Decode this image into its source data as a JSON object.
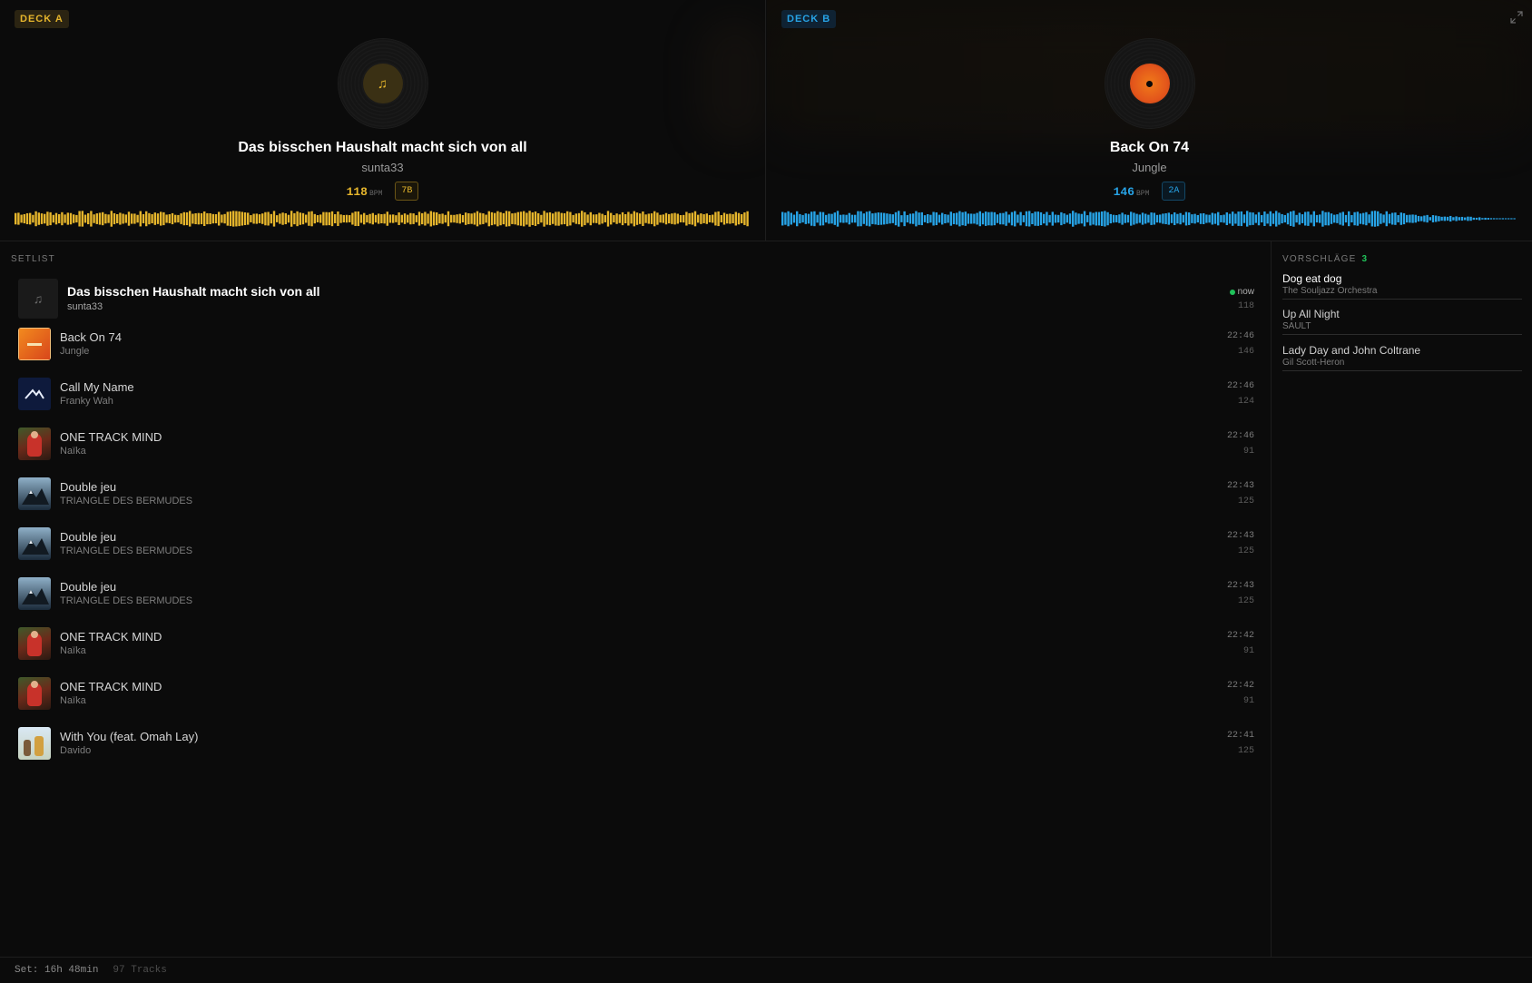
{
  "deck_a": {
    "badge": "DECK A",
    "title": "Das bisschen Haushalt macht sich von all",
    "artist": "sunta33",
    "bpm": "118",
    "bpm_unit": "BPM",
    "key": "7B",
    "accent": "#e5b52c"
  },
  "deck_b": {
    "badge": "DECK B",
    "title": "Back On 74",
    "artist": "Jungle",
    "bpm": "146",
    "bpm_unit": "BPM",
    "key": "2A",
    "accent": "#27a3e6"
  },
  "setlist": {
    "label": "SETLIST",
    "current": {
      "title": "Das bisschen Haushalt macht sich von all",
      "artist": "sunta33",
      "now": "now",
      "bpm": "118"
    },
    "tracks": [
      {
        "title": "Back On 74",
        "artist": "Jungle",
        "time": "22:46",
        "bpm": "146",
        "art": "jungle"
      },
      {
        "title": "Call My Name",
        "artist": "Franky Wah",
        "time": "22:46",
        "bpm": "124",
        "art": "anjuna"
      },
      {
        "title": "ONE TRACK MIND",
        "artist": "Naïka",
        "time": "22:46",
        "bpm": "91",
        "art": "naika"
      },
      {
        "title": "Double jeu",
        "artist": "TRIANGLE DES BERMUDES",
        "time": "22:43",
        "bpm": "125",
        "art": "triangle"
      },
      {
        "title": "Double jeu",
        "artist": "TRIANGLE DES BERMUDES",
        "time": "22:43",
        "bpm": "125",
        "art": "triangle"
      },
      {
        "title": "Double jeu",
        "artist": "TRIANGLE DES BERMUDES",
        "time": "22:43",
        "bpm": "125",
        "art": "triangle"
      },
      {
        "title": "ONE TRACK MIND",
        "artist": "Naïka",
        "time": "22:42",
        "bpm": "91",
        "art": "naika"
      },
      {
        "title": "ONE TRACK MIND",
        "artist": "Naïka",
        "time": "22:42",
        "bpm": "91",
        "art": "naika"
      },
      {
        "title": "With You (feat. Omah Lay)",
        "artist": "Davido",
        "time": "22:41",
        "bpm": "125",
        "art": "davido"
      }
    ]
  },
  "suggestions": {
    "label": "VORSCHLÄGE",
    "count": "3",
    "items": [
      {
        "title": "Dog eat dog",
        "artist": "The Souljazz Orchestra"
      },
      {
        "title": "Up All Night",
        "artist": "SAULT"
      },
      {
        "title": "Lady Day and John Coltrane",
        "artist": "Gil Scott-Heron"
      }
    ]
  },
  "footer": {
    "set": "Set: 16h 48min",
    "tracks": "97 Tracks"
  },
  "icons": {
    "expand": "expand-icon",
    "music_note": "music-note-icon"
  }
}
